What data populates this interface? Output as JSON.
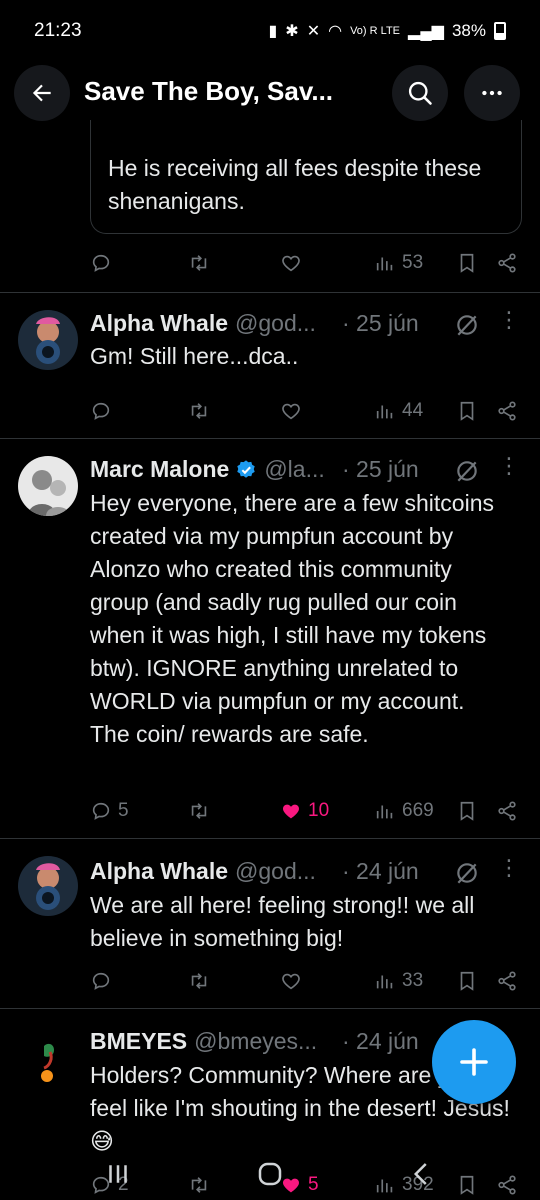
{
  "status": {
    "time": "21:23",
    "right_text": "Vo) R LTE",
    "battery": "38%"
  },
  "header": {
    "title": "Save The Boy, Sav..."
  },
  "quoted": {
    "text": "He is receiving all fees despite these shenanigans."
  },
  "tweets": [
    {
      "name": "",
      "actions": {
        "replies": "",
        "likes": "",
        "views": "53"
      }
    },
    {
      "name": "Alpha Whale",
      "handle": "@god...",
      "date": "· 25 jún",
      "text": "Gm! Still here...dca..",
      "actions": {
        "replies": "",
        "likes": "",
        "views": "44"
      }
    },
    {
      "name": "Marc Malone",
      "handle": "@la...",
      "date": "· 25 jún",
      "text": "Hey everyone, there are a few shitcoins created via my pumpfun account by Alonzo who created this community group (and sadly rug pulled our coin when it was high, I still have my tokens btw). IGNORE anything unrelated to WORLD via pumpfun or my account. The coin/ rewards are safe.",
      "actions": {
        "replies": "5",
        "likes": "10",
        "views": "669"
      }
    },
    {
      "name": "Alpha Whale",
      "handle": "@god...",
      "date": "· 24 jún",
      "text": "We are all here! feeling strong!! we all believe in something big!",
      "actions": {
        "replies": "",
        "likes": "",
        "views": "33"
      }
    },
    {
      "name": "BMEYES",
      "handle": "@bmeyes...",
      "date": "· 24 jún",
      "text": "Holders? Community? Where are you? I feel like I'm shouting in the desert! Jesus! 😅",
      "actions": {
        "replies": "2",
        "likes": "5",
        "views": "392"
      }
    }
  ],
  "colors": {
    "background": "#000000",
    "text": "#e7e9ea",
    "muted": "#71767b",
    "like": "#f91880",
    "accent": "#1d9bf0",
    "divider": "#2f3336"
  }
}
